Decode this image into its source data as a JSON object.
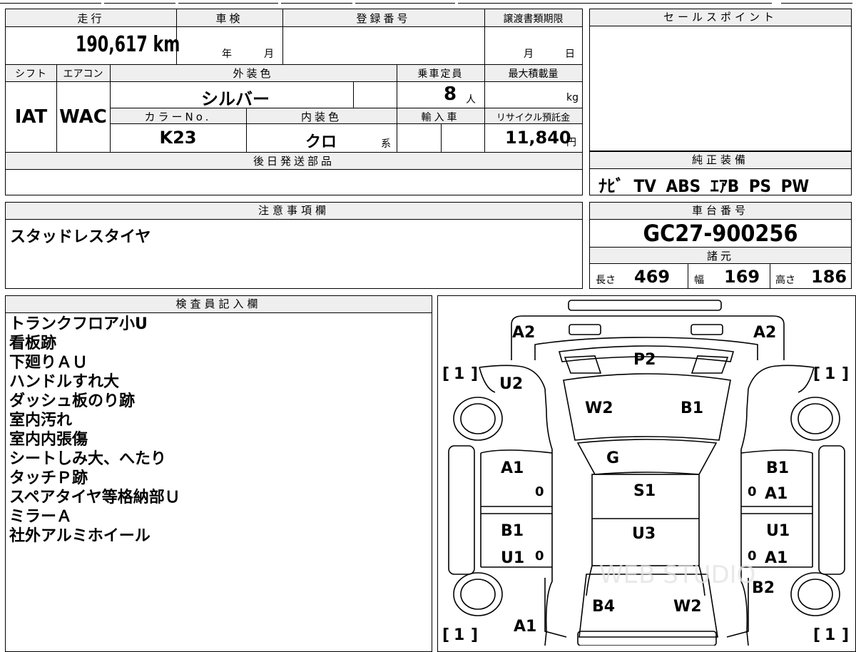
{
  "mileage": {
    "label": "走行",
    "value": "190,617",
    "unit": "km"
  },
  "inspection": {
    "label": "車検",
    "year": "年",
    "month": "月"
  },
  "registration": {
    "label": "登録番号",
    "value": ""
  },
  "transfer_deadline": {
    "label": "譲渡書類期限",
    "month": "月",
    "day": "日"
  },
  "sales_point": {
    "label": "セールスポイント",
    "value": ""
  },
  "shift": {
    "label": "シフト",
    "value": "IAT"
  },
  "aircon": {
    "label": "エアコン",
    "value": "WAC"
  },
  "exterior_color": {
    "label": "外装色",
    "value": "シルバー"
  },
  "capacity": {
    "label": "乗車定員",
    "value": "8",
    "unit": "人"
  },
  "max_load": {
    "label": "最大積載量",
    "unit": "kg"
  },
  "color_no": {
    "label": "カラーNo.",
    "value": "K23"
  },
  "interior_color": {
    "label": "内装色",
    "value": "クロ",
    "unit": "系"
  },
  "import": {
    "label": "輸入車"
  },
  "recycle_fee": {
    "label": "リサイクル預託金",
    "value": "11,840",
    "unit": "円"
  },
  "later_parts": {
    "label": "後日発送部品",
    "value": ""
  },
  "genuine_equipment": {
    "label": "純正装備",
    "items": [
      "ﾅﾋﾞ",
      "TV",
      "ABS",
      "ｴｱB",
      "PS",
      "PW"
    ]
  },
  "caution": {
    "label": "注意事項欄",
    "value": "スタッドレスタイヤ"
  },
  "chassis_number": {
    "label": "車台番号",
    "value": "GC27-900256"
  },
  "specs": {
    "label": "諸元",
    "length": {
      "label": "長さ",
      "value": "469"
    },
    "width": {
      "label": "幅",
      "value": "169"
    },
    "height": {
      "label": "高さ",
      "value": "186"
    }
  },
  "inspector_notes": {
    "label": "検査員記入欄",
    "lines": [
      "トランクフロア小U",
      "看板跡",
      "下廻りＡＵ",
      "ハンドルすれ大",
      "ダッシュ板のり跡",
      "室内汚れ",
      "室内内張傷",
      "シートしみ大、へたり",
      "タッチＰ跡",
      "スペアタイヤ等格納部Ｕ",
      "ミラーＡ",
      "社外アルミホイール"
    ]
  },
  "diagram": {
    "watermark": "WEB STUDIO",
    "tire_marks": {
      "front_left": "1",
      "front_right": "1",
      "rear_left": "1",
      "rear_right": "1"
    },
    "zeros": [
      "0",
      "0",
      "0",
      "0"
    ],
    "codes": {
      "rear_bumper_left": "A2",
      "rear_bumper_right": "A2",
      "rear_glass": "P2",
      "rear_left_quarter": "U2",
      "roof_left": "W2",
      "roof_right": "B1",
      "windshield": "G",
      "left_rear_door": "A1",
      "right_rear_door_1": "B1",
      "right_rear_door_2": "A1",
      "seat_1": "S1",
      "seat_2": "U3",
      "left_front_door_1": "B1",
      "left_front_door_2": "U1",
      "right_front_door_1": "U1",
      "right_front_door_2": "A1",
      "right_front_fender": "B2",
      "hood_left": "B4",
      "hood_right": "W2",
      "front_left": "A1"
    }
  }
}
